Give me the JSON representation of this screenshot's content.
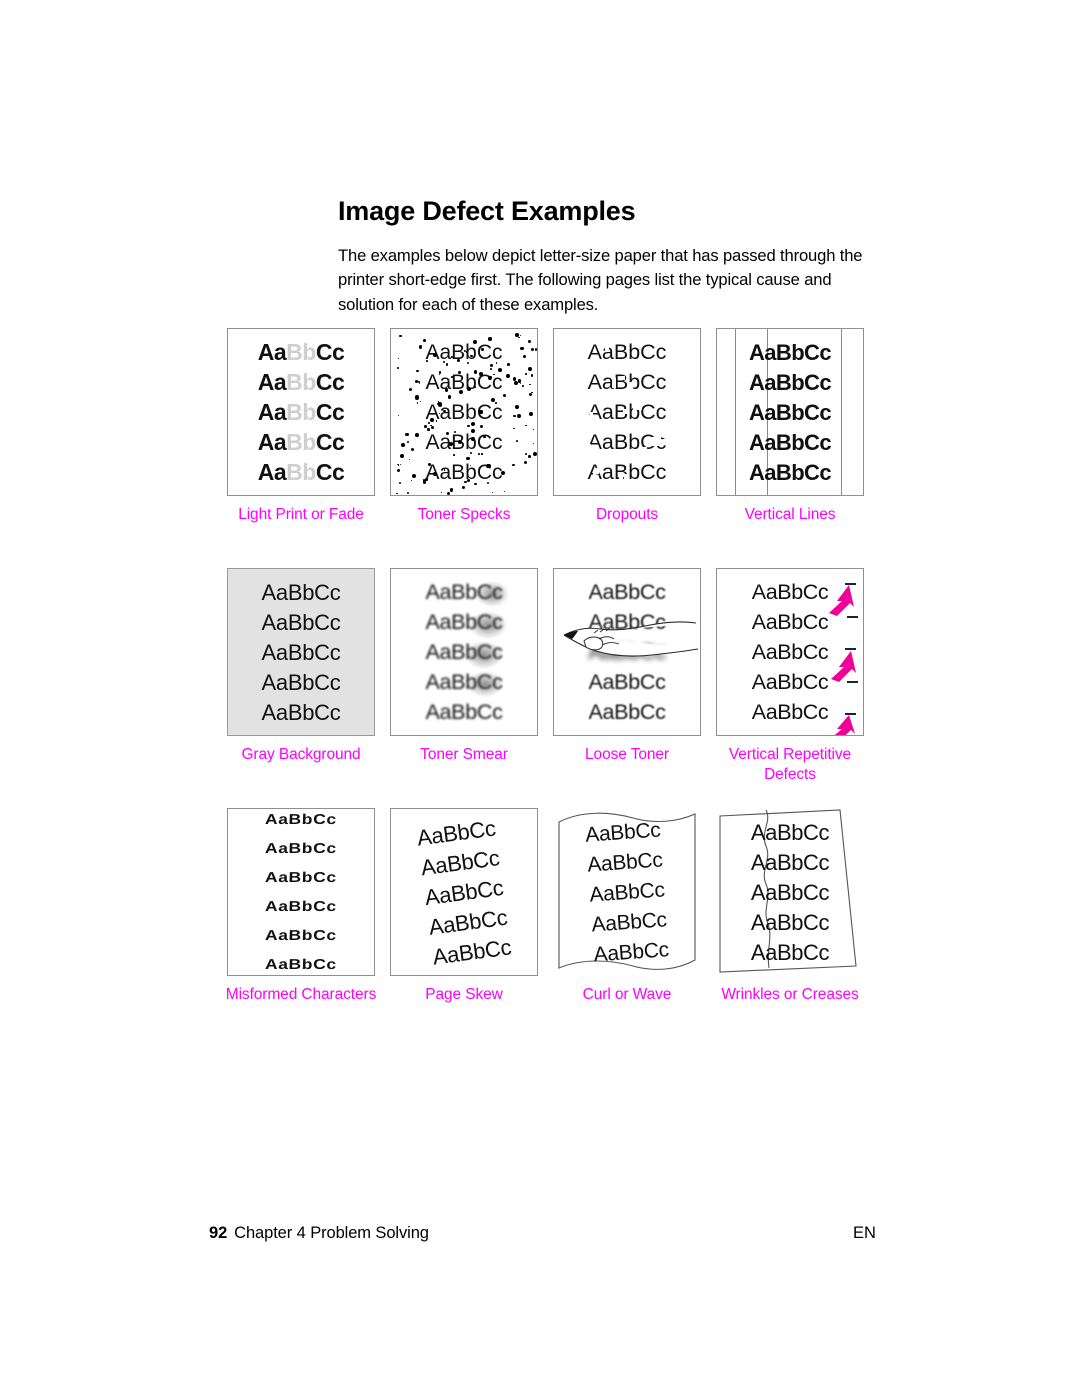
{
  "page": {
    "heading": "Image Defect Examples",
    "intro": "The examples below depict letter-size paper that has passed through the printer short-edge first. The following pages list the typical cause and solution for each of these examples.",
    "caption_color": "#ff00ff",
    "gray_background_color": "#e2e2e2"
  },
  "samples": [
    {
      "id": "light-print-or-fade",
      "caption": "Light Print or Fade",
      "sample_text_dark": "Aa",
      "sample_text_faded": "Bb",
      "sample_text_dark2": "Cc",
      "line_count": 5
    },
    {
      "id": "toner-specks",
      "caption": "Toner Specks",
      "sample_text": "AaBbCc",
      "line_count": 5
    },
    {
      "id": "dropouts",
      "caption": "Dropouts",
      "sample_text": "AaBbCc",
      "line_count": 5
    },
    {
      "id": "vertical-lines",
      "caption": "Vertical Lines",
      "sample_text": "AaBbCc",
      "line_count": 5
    },
    {
      "id": "gray-background",
      "caption": "Gray Background",
      "sample_text": "AaBbCc",
      "line_count": 5
    },
    {
      "id": "toner-smear",
      "caption": "Toner Smear",
      "sample_text": "AaBbCc",
      "line_count": 5
    },
    {
      "id": "loose-toner",
      "caption": "Loose Toner",
      "sample_text": "AaBbCc",
      "line_count": 5
    },
    {
      "id": "vertical-repetitive-defects",
      "caption": "Vertical Repetitive Defects",
      "sample_text": "AaBbCc",
      "line_count": 5
    },
    {
      "id": "misformed-characters",
      "caption": "Misformed Characters",
      "sample_text": "AaBbCc",
      "line_count": 6
    },
    {
      "id": "page-skew",
      "caption": "Page Skew",
      "sample_text": "AaBbCc",
      "line_count": 5
    },
    {
      "id": "curl-or-wave",
      "caption": "Curl or Wave",
      "sample_text": "AaBbCc",
      "line_count": 5
    },
    {
      "id": "wrinkles-or-creases",
      "caption": "Wrinkles or Creases",
      "sample_text": "AaBbCc",
      "line_count": 5
    }
  ],
  "footer": {
    "page_number": "92",
    "chapter": "Chapter 4 Problem Solving",
    "language": "EN"
  }
}
